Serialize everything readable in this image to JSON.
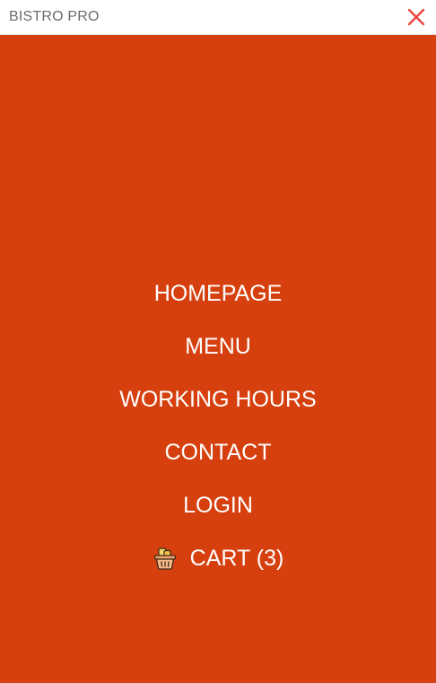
{
  "header": {
    "brand": "BISTRO PRO",
    "close_icon": "close-icon",
    "close_color": "#e8453c"
  },
  "panel": {
    "background": "#d6400f"
  },
  "nav": {
    "items": [
      {
        "label": "HOMEPAGE"
      },
      {
        "label": "MENU"
      },
      {
        "label": "WORKING HOURS"
      },
      {
        "label": "CONTACT"
      },
      {
        "label": "LOGIN"
      }
    ],
    "cart": {
      "icon": "shopping-basket-icon",
      "label": "CART (3)"
    }
  }
}
